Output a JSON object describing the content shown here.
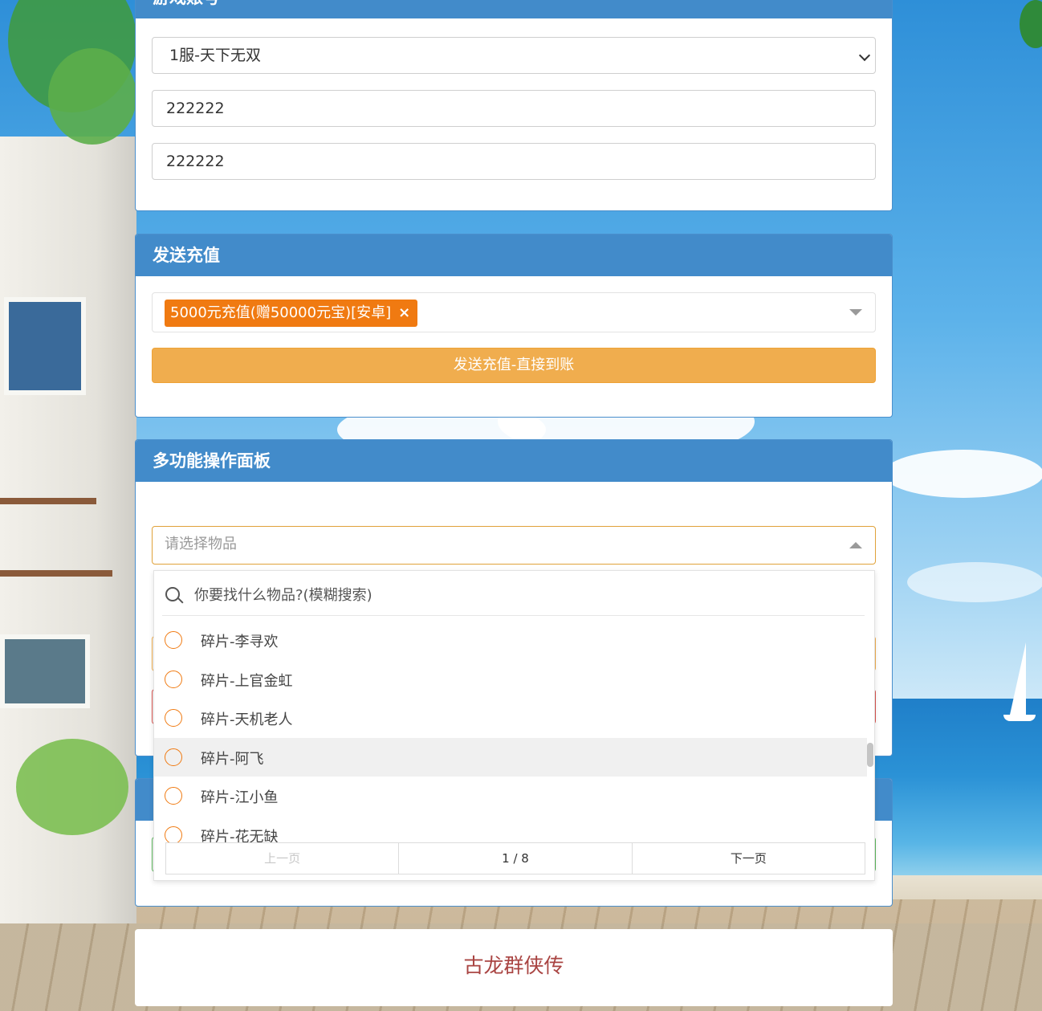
{
  "account_panel": {
    "title": "游戏账号",
    "server_select": "1服-天下无双",
    "account_field": "222222",
    "password_field": "222222"
  },
  "recharge_panel": {
    "title": "发送充值",
    "selected_tag": "5000元充值(赠50000元宝)[安卓]",
    "tag_remove": "×",
    "send_button": "发送充值-直接到账"
  },
  "multi_panel": {
    "title": "多功能操作面板",
    "item_placeholder": "请选择物品",
    "search_placeholder": "你要找什么物品?(模糊搜索)",
    "items": [
      {
        "label": "碎片-李寻欢"
      },
      {
        "label": "碎片-上官金虹"
      },
      {
        "label": "碎片-天机老人"
      },
      {
        "label": "碎片-阿飞"
      },
      {
        "label": "碎片-江小鱼"
      },
      {
        "label": "碎片-花无缺"
      }
    ],
    "pager": {
      "prev": "上一页",
      "page": "1 / 8",
      "next": "下一页"
    }
  },
  "footer": {
    "title": "古龙群侠传"
  },
  "colors": {
    "panel_header": "#428bca",
    "tag_orange": "#f07a11",
    "send_button": "#f0ad4e",
    "footer_text": "#a94442"
  }
}
